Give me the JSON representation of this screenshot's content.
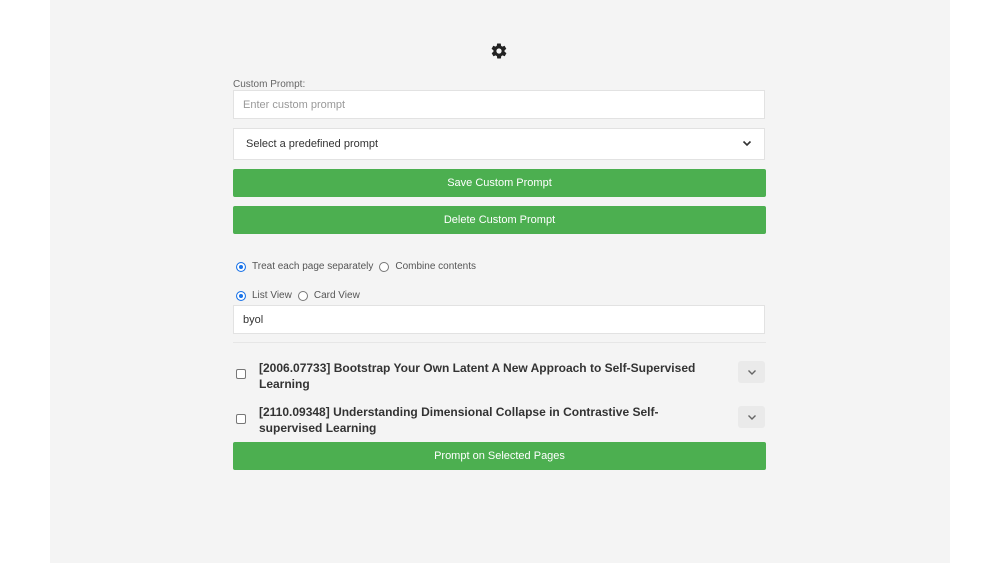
{
  "icons": {
    "settings": "gear-icon",
    "select_arrow": "chevron-down-icon",
    "expand": "chevron-down-icon"
  },
  "colors": {
    "accent": "#4caf50",
    "radio_selected": "#1a73e8",
    "background": "#f4f4f4"
  },
  "custom_prompt": {
    "label": "Custom Prompt:",
    "placeholder": "Enter custom prompt",
    "value": ""
  },
  "predefined_select": {
    "selected": "Select a predefined prompt"
  },
  "buttons": {
    "save": "Save Custom Prompt",
    "delete": "Delete Custom Prompt",
    "prompt_selected": "Prompt on Selected Pages"
  },
  "mode_options": [
    {
      "label": "Treat each page separately",
      "selected": true
    },
    {
      "label": "Combine contents",
      "selected": false
    }
  ],
  "view_options": [
    {
      "label": "List View",
      "selected": true
    },
    {
      "label": "Card View",
      "selected": false
    }
  ],
  "search": {
    "value": "byol"
  },
  "pages": [
    {
      "title": "[2006.07733] Bootstrap Your Own Latent A New Approach to Self-Supervised Learning",
      "checked": false
    },
    {
      "title": "[2110.09348] Understanding Dimensional Collapse in Contrastive Self-supervised Learning",
      "checked": false
    }
  ]
}
